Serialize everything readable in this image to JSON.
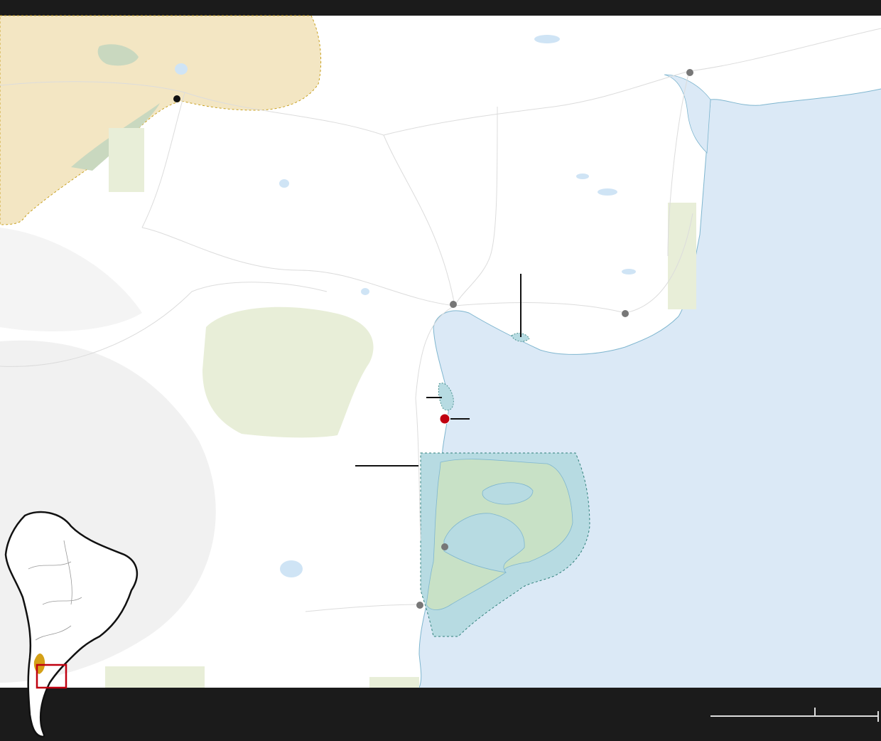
{
  "map": {
    "colors": {
      "frame": "#1b1b1b",
      "land": "#ffffff",
      "ocean": "#dbe9f6",
      "protected_area": "#f0d9a8",
      "park_land": "#c8e1c6",
      "marine_area": "#b7dbe2",
      "green_zone": "#e8eed8",
      "marker_gray": "#777777",
      "marker_red": "#c00010",
      "inset_box": "#c00010"
    },
    "icons": {
      "city": "gray-dot",
      "capital": "black-dot",
      "site": "red-dot"
    },
    "scale_bar": {
      "label": "",
      "unit": ""
    }
  }
}
